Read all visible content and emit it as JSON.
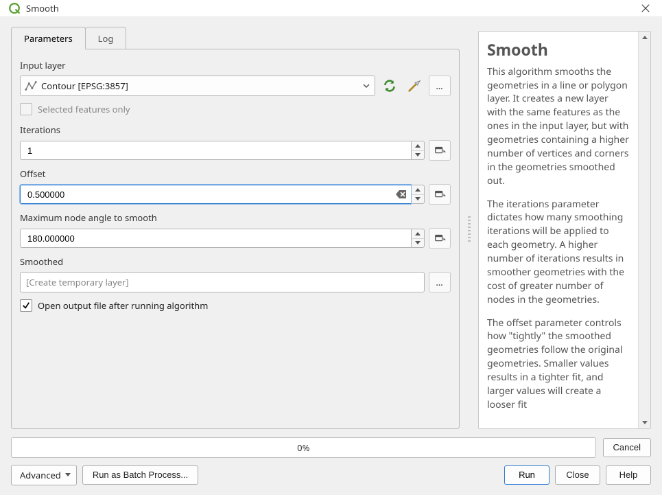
{
  "window": {
    "title": "Smooth"
  },
  "tabs": {
    "parameters": "Parameters",
    "log": "Log"
  },
  "labels": {
    "input_layer": "Input layer",
    "selected_only": "Selected features only",
    "iterations": "Iterations",
    "offset": "Offset",
    "max_angle": "Maximum node angle to smooth",
    "smoothed": "Smoothed",
    "open_after": "Open output file after running algorithm"
  },
  "values": {
    "input_layer": "Contour [EPSG:3857]",
    "iterations": "1",
    "offset": "0.500000",
    "max_angle": "180.000000",
    "smoothed_placeholder": "[Create temporary layer]"
  },
  "progress": {
    "text": "0%"
  },
  "buttons": {
    "cancel": "Cancel",
    "advanced": "Advanced",
    "batch": "Run as Batch Process...",
    "run": "Run",
    "close": "Close",
    "help": "Help"
  },
  "help": {
    "title": "Smooth",
    "p1": "This algorithm smooths the geometries in a line or polygon layer. It creates a new layer with the same features as the ones in the input layer, but with geometries containing a higher number of vertices and corners in the geometries smoothed out.",
    "p2": "The iterations parameter dictates how many smoothing iterations will be applied to each geometry. A higher number of iterations results in smoother geometries with the cost of greater number of nodes in the geometries.",
    "p3": "The offset parameter controls how \"tightly\" the smoothed geometries follow the original geometries. Smaller values results in a tighter fit, and larger values will create a looser fit"
  }
}
